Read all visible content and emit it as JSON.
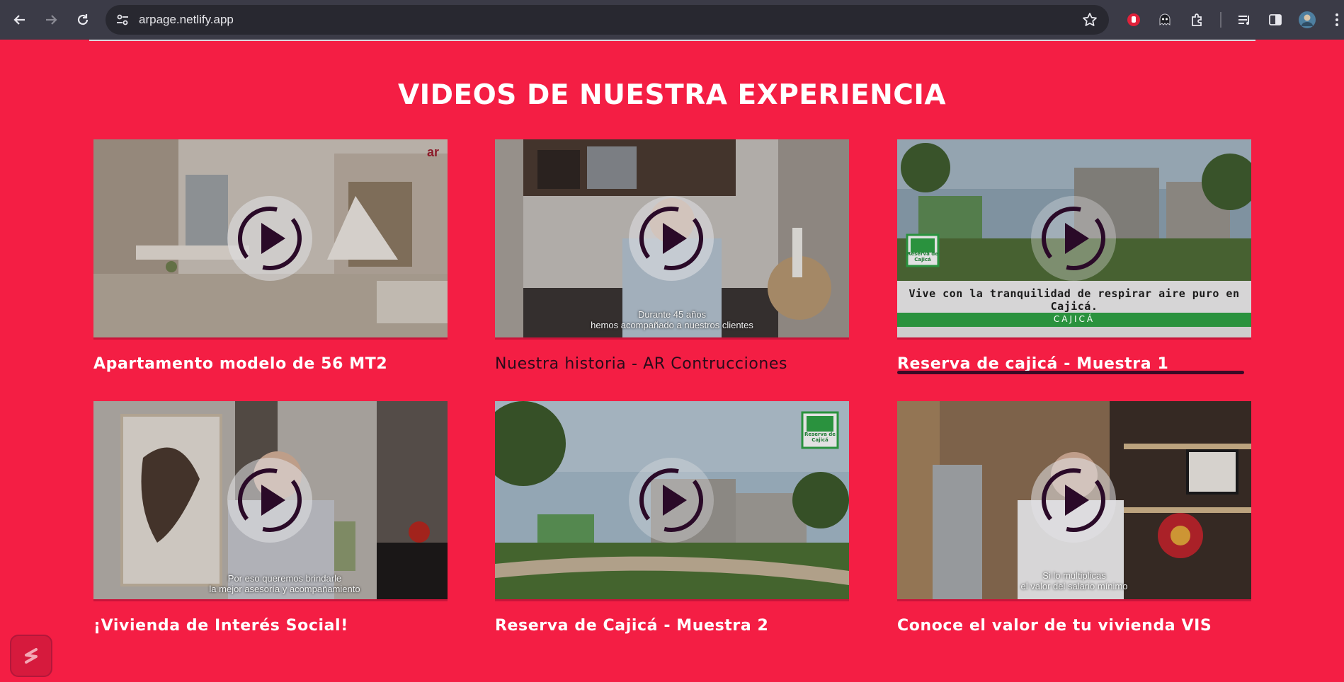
{
  "browser": {
    "url": "arpage.netlify.app",
    "icons": {
      "back": "arrow-left-icon",
      "forward": "arrow-right-icon",
      "reload": "reload-icon",
      "site_info": "tune-icon",
      "bookmark": "star-icon",
      "extensions": [
        "stop-hand-extension-icon",
        "ghost-extension-icon",
        "puzzle-extensions-icon",
        "reading-list-icon",
        "side-panel-icon",
        "profile-avatar-icon",
        "more-vert-icon"
      ]
    }
  },
  "page": {
    "heading": "VIDEOS DE NUESTRA EXPERIENCIA",
    "background_color": "#F41E44",
    "videos": [
      {
        "title": "Apartamento modelo de 56 MT2",
        "watermark": "ar",
        "caption": ""
      },
      {
        "title": "Nuestra historia - AR Contrucciones",
        "watermark": "",
        "caption_line1": "Durante 45 años",
        "caption_line2": "hemos acompañado a nuestros clientes"
      },
      {
        "title": "Reserva de cajicá - Muestra 1",
        "badge_line1": "Reserva de",
        "badge_line2": "Cajicá",
        "banner_text": "Vive con la tranquilidad de respirar aire puro en Cajicá.",
        "banner_sub": "CAJICÁ"
      },
      {
        "title": "¡Vivienda de Interés Social!",
        "caption_line1": "Por eso queremos brindarle",
        "caption_line2": "la mejor asesoría y acompañamiento"
      },
      {
        "title": "Reserva de Cajicá - Muestra 2",
        "badge_line1": "Reserva de",
        "badge_line2": "Cajicá"
      },
      {
        "title": "Conoce el valor de tu vivienda VIS",
        "caption_line1": "Si lo multiplicas",
        "caption_line2": "el valor del salario mínimo"
      }
    ]
  },
  "colors": {
    "accent": "#F41E44",
    "play_ring": "#2A0A28",
    "underline": "#3A0A26"
  }
}
